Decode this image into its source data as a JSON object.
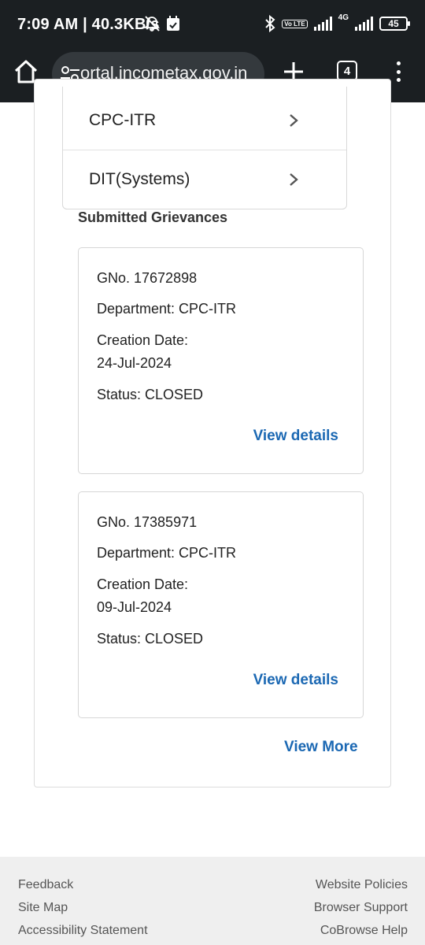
{
  "status_bar": {
    "time_speed": "7:09 AM | 40.3KB/s",
    "network_tag": "Vo LTE",
    "network_gen": "4G",
    "battery": "45"
  },
  "browser": {
    "url": "ortal.incometax.gov.in",
    "tab_count": "4"
  },
  "departments": [
    {
      "label": "CPC-ITR"
    },
    {
      "label": "DIT(Systems)"
    }
  ],
  "section_title": "Submitted Grievances",
  "grievances": [
    {
      "gno": "GNo. 17672898",
      "department": "Department: CPC-ITR",
      "creation_date_label": "Creation Date:",
      "creation_date": "24-Jul-2024",
      "status": "Status: CLOSED",
      "action": "View details"
    },
    {
      "gno": "GNo. 17385971",
      "department": "Department: CPC-ITR",
      "creation_date_label": "Creation Date:",
      "creation_date": "09-Jul-2024",
      "status": "Status: CLOSED",
      "action": "View details"
    }
  ],
  "view_more": "View More",
  "footer": {
    "left": [
      "Feedback",
      "Site Map",
      "Accessibility Statement"
    ],
    "right": [
      "Website Policies",
      "Browser Support",
      "CoBrowse Help"
    ]
  },
  "colors": {
    "toolbar_bg": "#1b1f22",
    "link": "#1b68b3",
    "footer_bg": "#efefef"
  }
}
